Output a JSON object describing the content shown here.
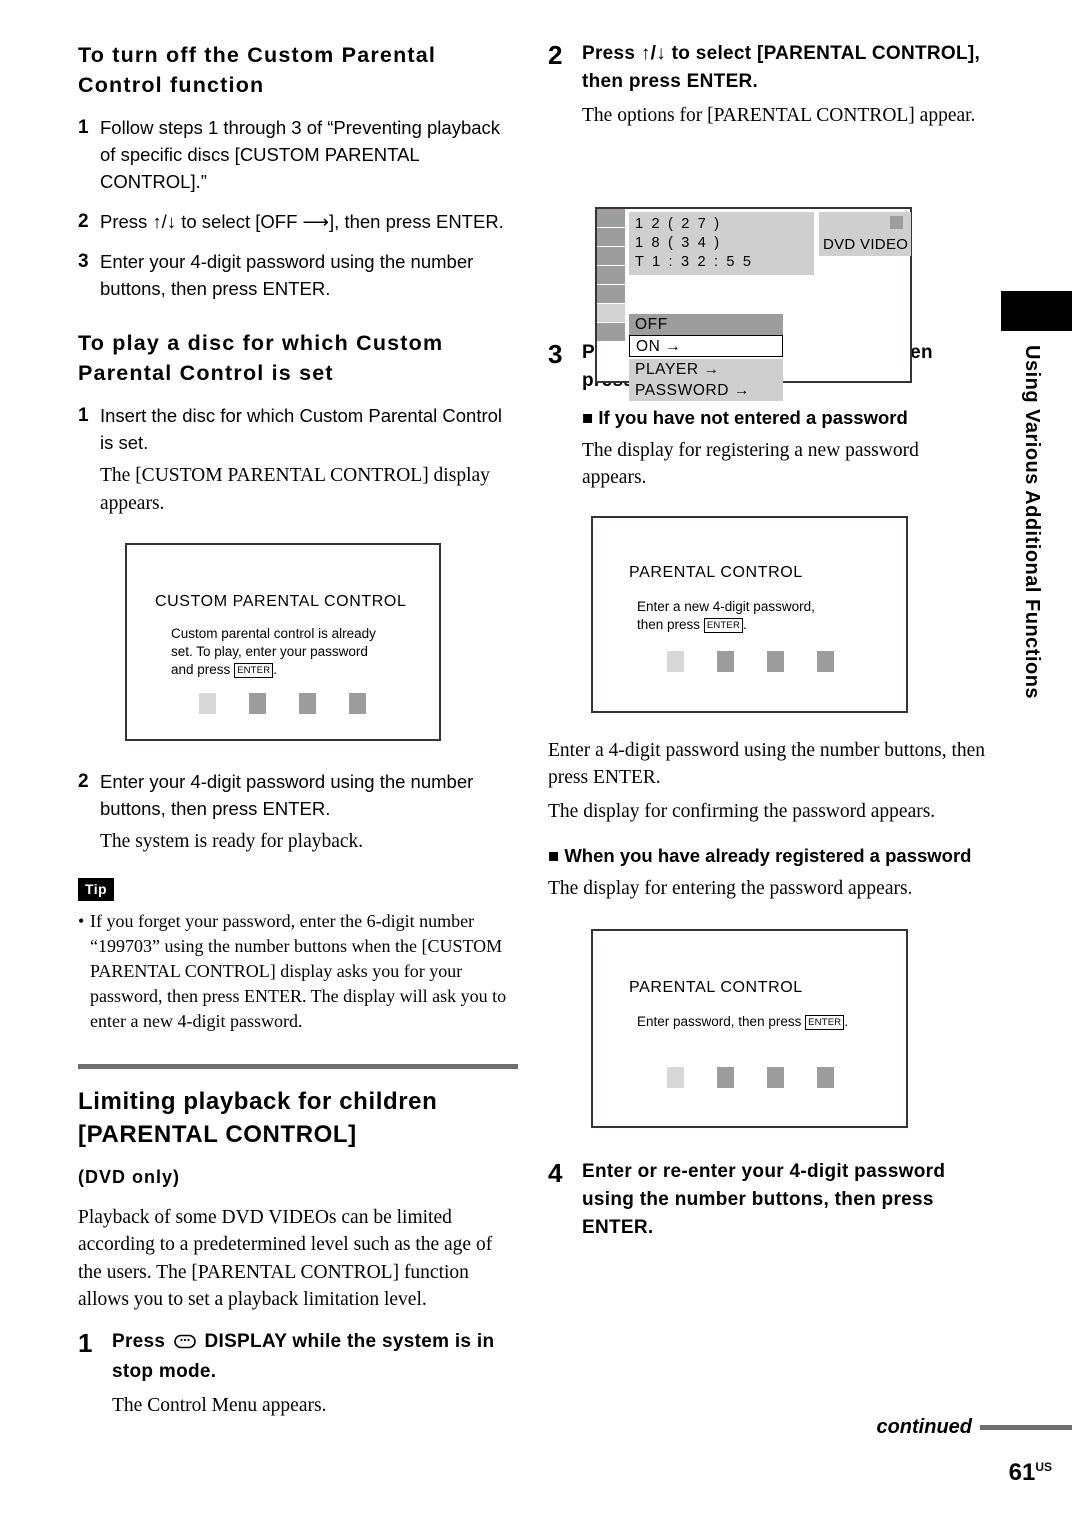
{
  "left_column": {
    "heading1": "To turn off the Custom Parental Control function",
    "steps1": [
      {
        "num": "1",
        "text": "Follow steps 1 through 3 of “Preventing playback of specific discs [CUSTOM PARENTAL CONTROL].”"
      },
      {
        "num": "2",
        "text": "Press ↑/↓ to select [OFF ⟶], then press ENTER."
      },
      {
        "num": "3",
        "text": "Enter your 4-digit password using the number buttons, then press ENTER."
      }
    ],
    "heading2": "To play a disc for which Custom Parental Control is set",
    "step2_1_num": "1",
    "step2_1_text": "Insert the disc for which Custom Parental Control is set.",
    "step2_1_note": "The [CUSTOM PARENTAL CONTROL] display appears.",
    "step2_2_num": "2",
    "step2_2_text": "Enter your 4-digit password using the number buttons, then press ENTER.",
    "step2_2_note": "The system is ready for playback.",
    "tip_label": "Tip",
    "tip_bullet": "•",
    "tip_text": "If you forget your password, enter the 6-digit number “199703” using the number buttons when the [CUSTOM PARENTAL CONTROL] display asks you for your password, then press ENTER. The display will ask you to enter a new 4-digit password.",
    "heading3_line1": "Limiting playback for children",
    "heading3_line2": "[PARENTAL CONTROL]",
    "dvd_only": "(DVD only)",
    "intro_paragraph": "Playback of some DVD VIDEOs can be limited according to a predetermined level such as the age of the users. The [PARENTAL CONTROL] function allows you to set a playback limitation level.",
    "step3_num": "1",
    "step3_text_a": "Press",
    "step3_text_b": "DISPLAY while the system is in stop mode.",
    "step3_note": "The Control Menu appears."
  },
  "custom_parental_control_screen": {
    "title": "CUSTOM PARENTAL CONTROL",
    "line1": "Custom parental control is already",
    "line2": "set. To play, enter your password",
    "line3_a": "and press",
    "line3_key": "ENTER",
    "line3_b": ".",
    "password_boxes": 4
  },
  "right_column": {
    "step2_num": "2",
    "step2_text": "Press ↑/↓ to select [PARENTAL CONTROL], then press ENTER.",
    "step2_note": "The options for [PARENTAL CONTROL] appear.",
    "step3_num": "3",
    "step3_text": "Press ↑/↓ to select [PLAYER ⟶], then press ENTER.",
    "sub1_marker": "■",
    "sub1_heading": "If you have not entered a password",
    "sub1_note": "The display for registering a new password appears.",
    "mid_note1": "Enter a 4-digit password using the number buttons, then press ENTER.",
    "mid_note2": "The display for confirming the password appears.",
    "sub2_marker": "■",
    "sub2_heading": "When you have already registered a password",
    "sub2_note": "The display for entering the password appears.",
    "step4_num": "4",
    "step4_text": "Enter or re-enter your 4-digit password using the number buttons, then press ENTER."
  },
  "control_menu_screen": {
    "info_line1": "1 2 ( 2 7 )",
    "info_line2": "1 8 ( 3 4 )",
    "info_line3": "T   1 : 3 2 : 5 5",
    "badge_label": "DVD VIDEO",
    "options": [
      {
        "label": "OFF",
        "state": "selected"
      },
      {
        "label": "ON →",
        "state": "cursor"
      },
      {
        "label": "PLAYER →",
        "state": "plain"
      },
      {
        "label": "PASSWORD →",
        "state": "plain"
      }
    ],
    "icon_count": 7,
    "light_icon_index": 6
  },
  "parental_control_screen_new": {
    "title": "PARENTAL CONTROL",
    "line1": "Enter a new 4-digit password,",
    "line2_a": "then press",
    "line2_key": "ENTER",
    "line2_b": ".",
    "password_boxes": 4
  },
  "parental_control_screen_enter": {
    "title": "PARENTAL CONTROL",
    "line1_a": "Enter password, then press",
    "line1_key": "ENTER",
    "line1_b": ".",
    "password_boxes": 4
  },
  "side_tab": {
    "label": "Using Various Additional Functions"
  },
  "footer": {
    "continued": "continued",
    "page_number": "61",
    "page_suffix": "US"
  },
  "colors": {
    "rule": "#6e6e6e",
    "screen_border": "#3a3233",
    "ui_gray": "#9d9d9d",
    "ui_gray_light": "#d2d2d2",
    "ui_panel": "#cfcfcf"
  }
}
